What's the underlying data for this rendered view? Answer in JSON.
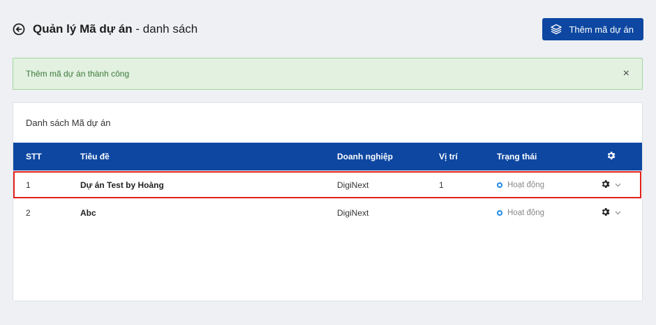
{
  "header": {
    "title_bold": "Quản lý Mã dự án",
    "title_rest": " - danh sách",
    "add_button_label": "Thêm mã dự án"
  },
  "icons": {
    "back": "arrow-left-circle-icon",
    "add": "layers-icon",
    "gear": "gear-icon",
    "chevron": "chevron-down-icon"
  },
  "alert": {
    "text": "Thêm mã dự án thành công",
    "close_label": "×"
  },
  "panel": {
    "title": "Danh sách Mã dự án"
  },
  "table": {
    "columns": {
      "stt": "STT",
      "title": "Tiêu đề",
      "company": "Doanh nghiệp",
      "position": "Vị trí",
      "status": "Trạng thái"
    },
    "rows": [
      {
        "stt": "1",
        "title": "Dự án Test by Hoàng",
        "company": "DigiNext",
        "position": "1",
        "status": "Hoạt động"
      },
      {
        "stt": "2",
        "title": "Abc",
        "company": "DigiNext",
        "position": "",
        "status": "Hoạt động"
      }
    ]
  },
  "colors": {
    "primary": "#0d47a1",
    "alert_bg": "#e2f1e0",
    "alert_text": "#3c7a3a",
    "highlight": "#e0201a",
    "status_dot": "#1e88e5"
  }
}
